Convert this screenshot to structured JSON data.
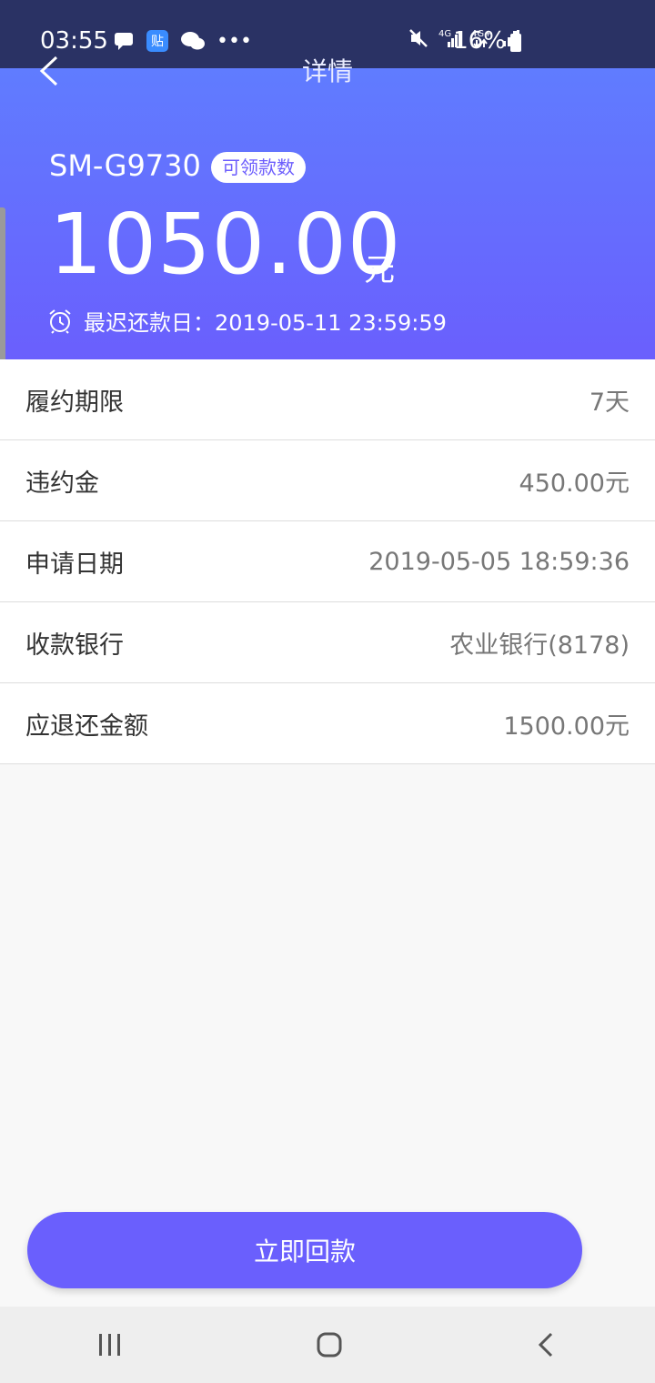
{
  "status_bar": {
    "time": "03:55",
    "battery": "16%",
    "net1": "4G",
    "net2": "4G+"
  },
  "header": {
    "title": "详情",
    "device": "SM-G9730",
    "badge": "可领款数",
    "amount": "1050.00",
    "unit": "元",
    "due_label": "最迟还款日：2019-05-11 23:59:59"
  },
  "rows": [
    {
      "label": "履约期限",
      "value": "7天"
    },
    {
      "label": "违约金",
      "value": "450.00元"
    },
    {
      "label": "申请日期",
      "value": "2019-05-05 18:59:36"
    },
    {
      "label": "收款银行",
      "value": "农业银行(8178)"
    },
    {
      "label": "应退还金额",
      "value": "1500.00元"
    }
  ],
  "cta": {
    "label": "立即回款"
  },
  "nav": {
    "recents_icon": "recents-icon",
    "home_icon": "home-icon",
    "back_icon": "back-icon"
  }
}
